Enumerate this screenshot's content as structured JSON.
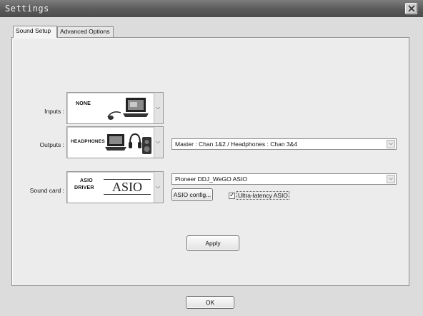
{
  "window": {
    "title": "Settings"
  },
  "tabs": [
    {
      "label": "Sound Setup",
      "active": true
    },
    {
      "label": "Advanced Options",
      "active": false
    }
  ],
  "inputs": {
    "label": "Inputs :",
    "selected": "NONE"
  },
  "outputs": {
    "label": "Outputs :",
    "selected": "HEADPHONES",
    "routing_value": "Master : Chan 1&2 / Headphones : Chan 3&4"
  },
  "sound_card": {
    "label": "Sound card :",
    "driver_line1": "ASIO",
    "driver_line2": "DRIVER",
    "driver_logo": "ASIO",
    "device_value": "Pioneer DDJ_WeGO ASIO",
    "config_button": "ASIO config...",
    "ultra_latency_label": "Ultra-latency ASIO",
    "ultra_latency_checked": true
  },
  "apply_button": "Apply",
  "ok_button": "OK",
  "icons": {
    "close": "close-icon",
    "dropdown": "chevron-down-icon",
    "laptop": "laptop-icon",
    "headphones": "headphones-icon",
    "speaker": "speaker-icon",
    "mouse": "mouse-icon"
  },
  "colors": {
    "titlebar": "#5c5c5c",
    "panel": "#ececec",
    "window": "#dcdcdc"
  }
}
